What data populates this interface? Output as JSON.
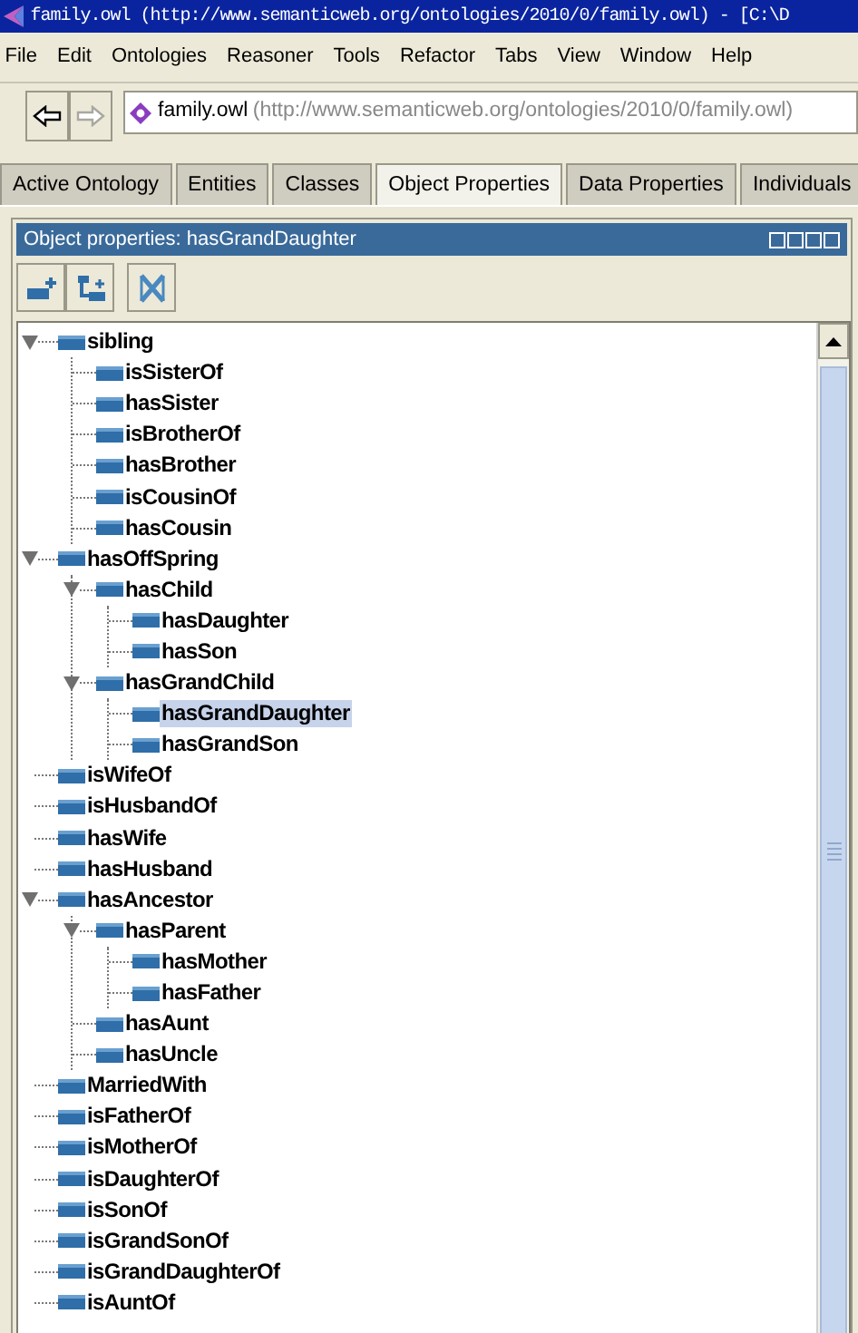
{
  "window": {
    "title": "family.owl (http://www.semanticweb.org/ontologies/2010/0/family.owl) - [C:\\D"
  },
  "menu": [
    "File",
    "Edit",
    "Ontologies",
    "Reasoner",
    "Tools",
    "Refactor",
    "Tabs",
    "View",
    "Window",
    "Help"
  ],
  "navigation": {
    "back_disabled": false,
    "forward_disabled": true,
    "ontology_name": "family.owl",
    "ontology_iri": "(http://www.semanticweb.org/ontologies/2010/0/family.owl)"
  },
  "tabs": [
    {
      "label": "Active Ontology",
      "selected": false
    },
    {
      "label": "Entities",
      "selected": false
    },
    {
      "label": "Classes",
      "selected": false
    },
    {
      "label": "Object Properties",
      "selected": true
    },
    {
      "label": "Data Properties",
      "selected": false
    },
    {
      "label": "Individuals",
      "selected": false
    }
  ],
  "panel": {
    "title": "Object properties: hasGrandDaughter"
  },
  "tree": [
    {
      "label": "sibling",
      "expanded": true,
      "selected": false,
      "children": [
        {
          "label": "isSisterOf",
          "expanded": false,
          "selected": false
        },
        {
          "label": "hasSister",
          "expanded": false,
          "selected": false
        },
        {
          "label": "isBrotherOf",
          "expanded": false,
          "selected": false
        },
        {
          "label": "hasBrother",
          "expanded": false,
          "selected": false
        },
        {
          "label": "isCousinOf",
          "expanded": false,
          "selected": false
        },
        {
          "label": "hasCousin",
          "expanded": false,
          "selected": false
        }
      ]
    },
    {
      "label": "hasOffSpring",
      "expanded": true,
      "selected": false,
      "children": [
        {
          "label": "hasChild",
          "expanded": true,
          "selected": false,
          "children": [
            {
              "label": "hasDaughter",
              "expanded": false,
              "selected": false
            },
            {
              "label": "hasSon",
              "expanded": false,
              "selected": false
            }
          ]
        },
        {
          "label": "hasGrandChild",
          "expanded": true,
          "selected": false,
          "children": [
            {
              "label": "hasGrandDaughter",
              "expanded": false,
              "selected": true
            },
            {
              "label": "hasGrandSon",
              "expanded": false,
              "selected": false
            }
          ]
        }
      ]
    },
    {
      "label": "isWifeOf",
      "expanded": false,
      "selected": false
    },
    {
      "label": "isHusbandOf",
      "expanded": false,
      "selected": false
    },
    {
      "label": "hasWife",
      "expanded": false,
      "selected": false
    },
    {
      "label": "hasHusband",
      "expanded": false,
      "selected": false
    },
    {
      "label": "hasAncestor",
      "expanded": true,
      "selected": false,
      "children": [
        {
          "label": "hasParent",
          "expanded": true,
          "selected": false,
          "children": [
            {
              "label": "hasMother",
              "expanded": false,
              "selected": false
            },
            {
              "label": "hasFather",
              "expanded": false,
              "selected": false
            }
          ]
        },
        {
          "label": "hasAunt",
          "expanded": false,
          "selected": false
        },
        {
          "label": "hasUncle",
          "expanded": false,
          "selected": false
        }
      ]
    },
    {
      "label": "MarriedWith",
      "expanded": false,
      "selected": false
    },
    {
      "label": "isFatherOf",
      "expanded": false,
      "selected": false
    },
    {
      "label": "isMotherOf",
      "expanded": false,
      "selected": false
    },
    {
      "label": "isDaughterOf",
      "expanded": false,
      "selected": false
    },
    {
      "label": "isSonOf",
      "expanded": false,
      "selected": false
    },
    {
      "label": "isGrandSonOf",
      "expanded": false,
      "selected": false
    },
    {
      "label": "isGrandDaughterOf",
      "expanded": false,
      "selected": false
    },
    {
      "label": "isAuntOf",
      "expanded": false,
      "selected": false
    }
  ]
}
